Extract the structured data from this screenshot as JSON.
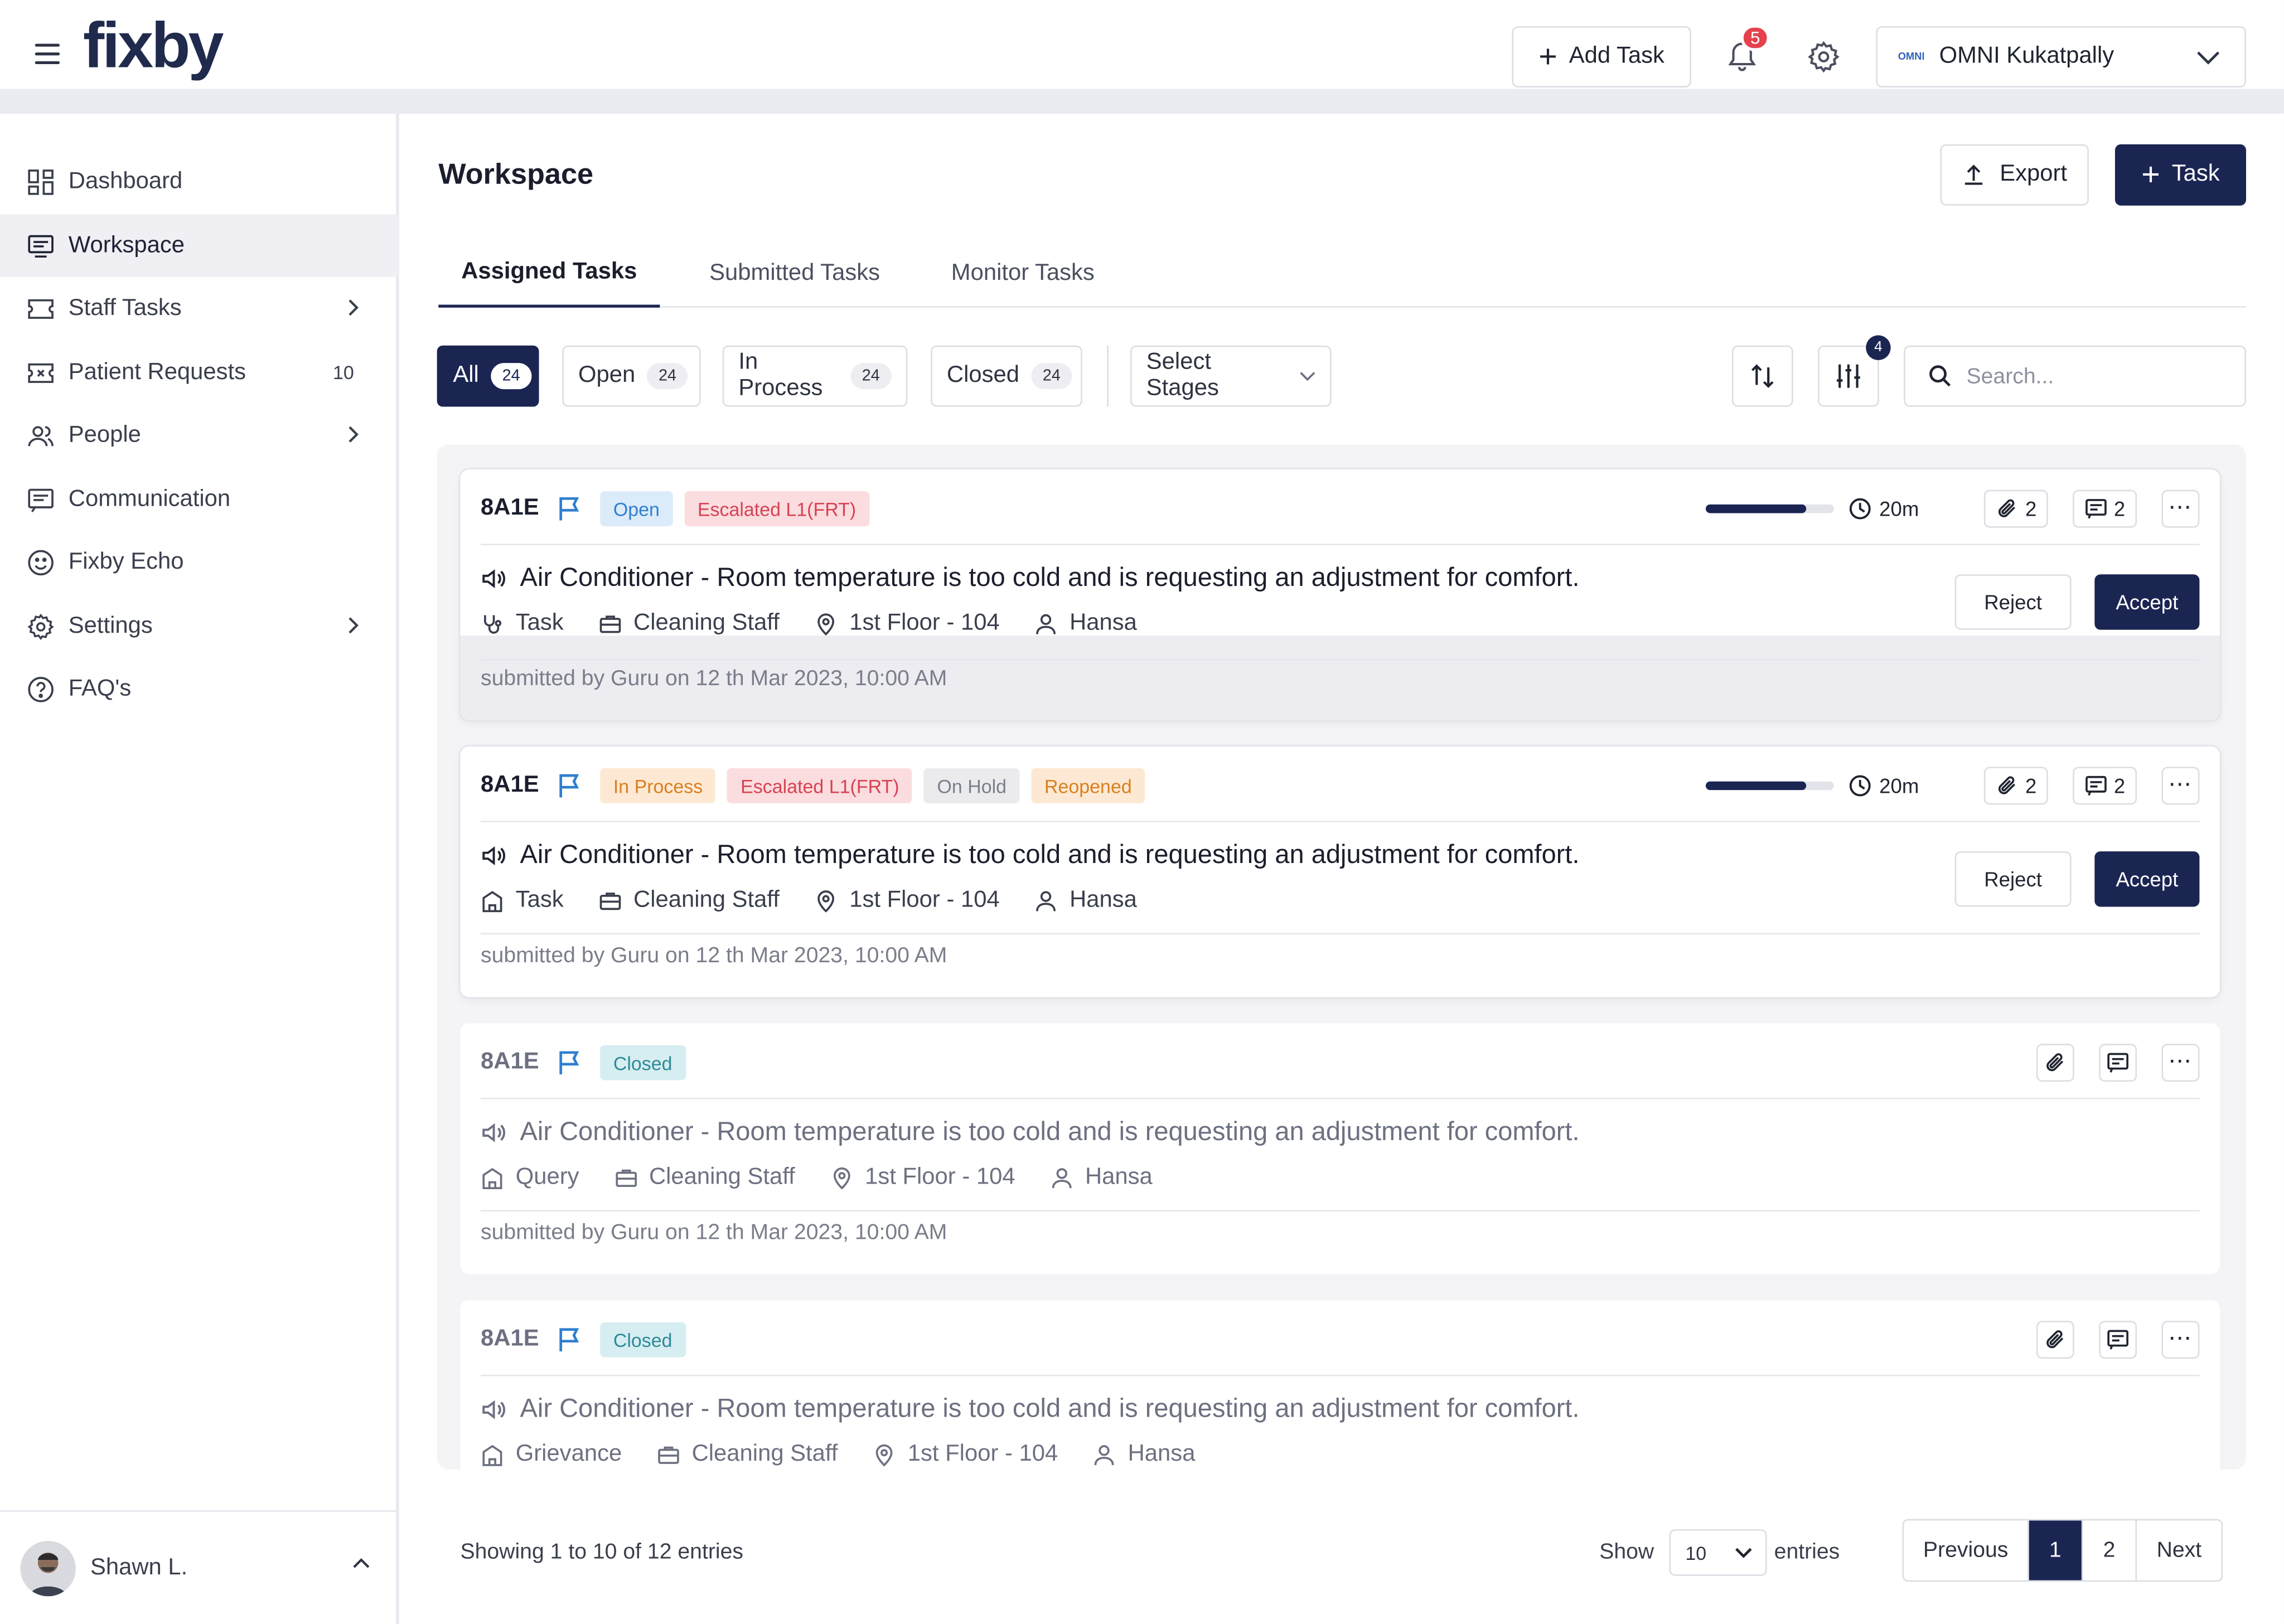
{
  "app": {
    "logo": "fixby",
    "add_task_label": "Add Task",
    "notification_count": "5",
    "hospital": "OMNI Kukatpally",
    "hospital_logo_text": "OMNI"
  },
  "sidebar": {
    "items": [
      {
        "label": "Dashboard",
        "icon": "dashboard-icon"
      },
      {
        "label": "Workspace",
        "icon": "workspace-icon",
        "active": true
      },
      {
        "label": "Staff Tasks",
        "icon": "ticket-icon",
        "has_children": true
      },
      {
        "label": "Patient Requests",
        "icon": "ticket-icon",
        "count": "10"
      },
      {
        "label": "People",
        "icon": "people-icon",
        "has_children": true
      },
      {
        "label": "Communication",
        "icon": "message-icon"
      },
      {
        "label": "Fixby Echo",
        "icon": "smiley-icon"
      },
      {
        "label": "Settings",
        "icon": "gear-icon",
        "has_children": true
      },
      {
        "label": "FAQ's",
        "icon": "help-icon"
      }
    ],
    "user": {
      "name": "Shawn L."
    }
  },
  "main": {
    "title": "Workspace",
    "export_label": "Export",
    "task_label": "Task",
    "tabs": [
      {
        "label": "Assigned Tasks",
        "active": true
      },
      {
        "label": "Submitted Tasks"
      },
      {
        "label": "Monitor Tasks"
      }
    ],
    "filters": [
      {
        "label": "All",
        "count": "24",
        "active": true
      },
      {
        "label": "Open",
        "count": "24"
      },
      {
        "label": "In Process",
        "count": "24"
      },
      {
        "label": "Closed",
        "count": "24"
      }
    ],
    "stages_label": "Select Stages",
    "filter_badge": "4",
    "search_placeholder": "Search..."
  },
  "tasks": [
    {
      "id": "8A1E",
      "tags": [
        {
          "label": "Open",
          "kind": "open"
        },
        {
          "label": "Escalated L1(FRT)",
          "kind": "esc"
        }
      ],
      "progress": 0.78,
      "time": "20m",
      "attachments": "2",
      "comments": "2",
      "title": "Air Conditioner - Room temperature is too cold and is requesting an adjustment for comfort.",
      "type": "Task",
      "department": "Cleaning Staff",
      "location": "1st Floor - 104",
      "assignee": "Hansa",
      "submitted": "submitted by Guru on 12 th Mar 2023, 10:00 AM",
      "reject_label": "Reject",
      "accept_label": "Accept"
    },
    {
      "id": "8A1E",
      "tags": [
        {
          "label": "In Process",
          "kind": "reop"
        },
        {
          "label": "Escalated L1(FRT)",
          "kind": "esc"
        },
        {
          "label": "On Hold",
          "kind": "hold"
        },
        {
          "label": "Reopened",
          "kind": "reop"
        }
      ],
      "progress": 0.78,
      "time": "20m",
      "attachments": "2",
      "comments": "2",
      "title": "Air Conditioner - Room temperature is too cold and is requesting an adjustment for comfort.",
      "type": "Task",
      "department": "Cleaning Staff",
      "location": "1st Floor - 104",
      "assignee": "Hansa",
      "submitted": "submitted by Guru on 12 th Mar 2023, 10:00 AM",
      "reject_label": "Reject",
      "accept_label": "Accept"
    },
    {
      "id": "8A1E",
      "tags": [
        {
          "label": "Closed",
          "kind": "closed"
        }
      ],
      "title": "Air Conditioner - Room temperature is too cold and is requesting an adjustment for comfort.",
      "type": "Query",
      "department": "Cleaning Staff",
      "location": "1st Floor - 104",
      "assignee": "Hansa",
      "submitted": "submitted by Guru on 12 th Mar 2023, 10:00 AM"
    },
    {
      "id": "8A1E",
      "tags": [
        {
          "label": "Closed",
          "kind": "closed"
        }
      ],
      "title": "Air Conditioner - Room temperature is too cold and is requesting an adjustment for comfort.",
      "type": "Grievance",
      "department": "Cleaning Staff",
      "location": "1st Floor - 104",
      "assignee": "Hansa"
    }
  ],
  "pagination": {
    "showing": "Showing 1 to 10 of 12 entries",
    "show_label": "Show",
    "per_page": "10",
    "entries_label": "entries",
    "previous": "Previous",
    "pages": [
      "1",
      "2"
    ],
    "current": "1",
    "next": "Next"
  },
  "colors": {
    "primary": "#1b2552",
    "open": "#2f7fcf",
    "escalated": "#d64352",
    "reopened": "#d8801f",
    "closed": "#2d8a98",
    "badge": "#e5414e"
  }
}
